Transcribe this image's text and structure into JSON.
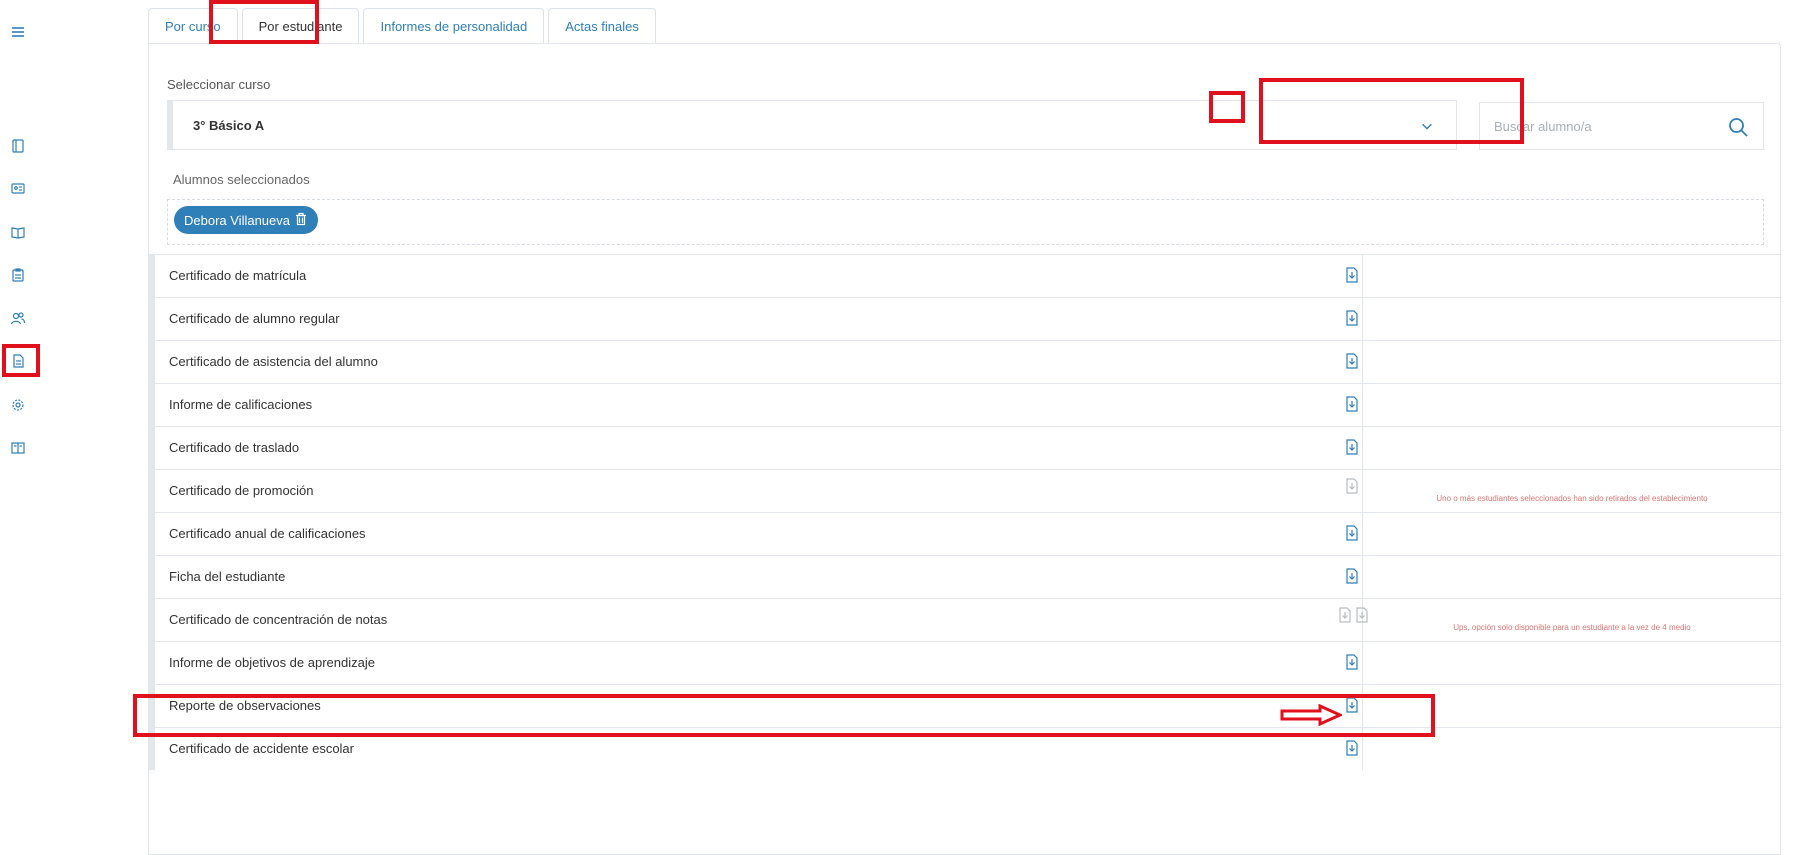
{
  "tabs": [
    {
      "label": "Por curso"
    },
    {
      "label": "Por estudiante"
    },
    {
      "label": "Informes de personalidad"
    },
    {
      "label": "Actas finales"
    }
  ],
  "course": {
    "label": "Seleccionar curso",
    "value": "3° Básico A"
  },
  "search": {
    "placeholder": "Buscar alumno/a"
  },
  "selected": {
    "label": "Alumnos seleccionados",
    "students": [
      "Debora Villanueva"
    ]
  },
  "documents": [
    {
      "label": "Certificado de matrícula"
    },
    {
      "label": "Certificado de alumno regular"
    },
    {
      "label": "Certificado de asistencia del alumno"
    },
    {
      "label": "Informe de calificaciones"
    },
    {
      "label": "Certificado de traslado"
    },
    {
      "label": "Certificado de promoción",
      "warning": "Uno o más estudiantes seleccionados han sido retirados del establecimiento"
    },
    {
      "label": "Certificado anual de calificaciones"
    },
    {
      "label": "Ficha del estudiante"
    },
    {
      "label": "Certificado de concentración de notas",
      "warning": "Ups, opción solo disponible para un estudiante a la vez de 4 medio"
    },
    {
      "label": "Informe de objetivos de aprendizaje"
    },
    {
      "label": "Reporte de observaciones"
    },
    {
      "label": "Certificado de accidente escolar"
    }
  ],
  "colors": {
    "accent": "#2f7fb8",
    "highlight": "#e0101c",
    "warning": "#e07474"
  }
}
